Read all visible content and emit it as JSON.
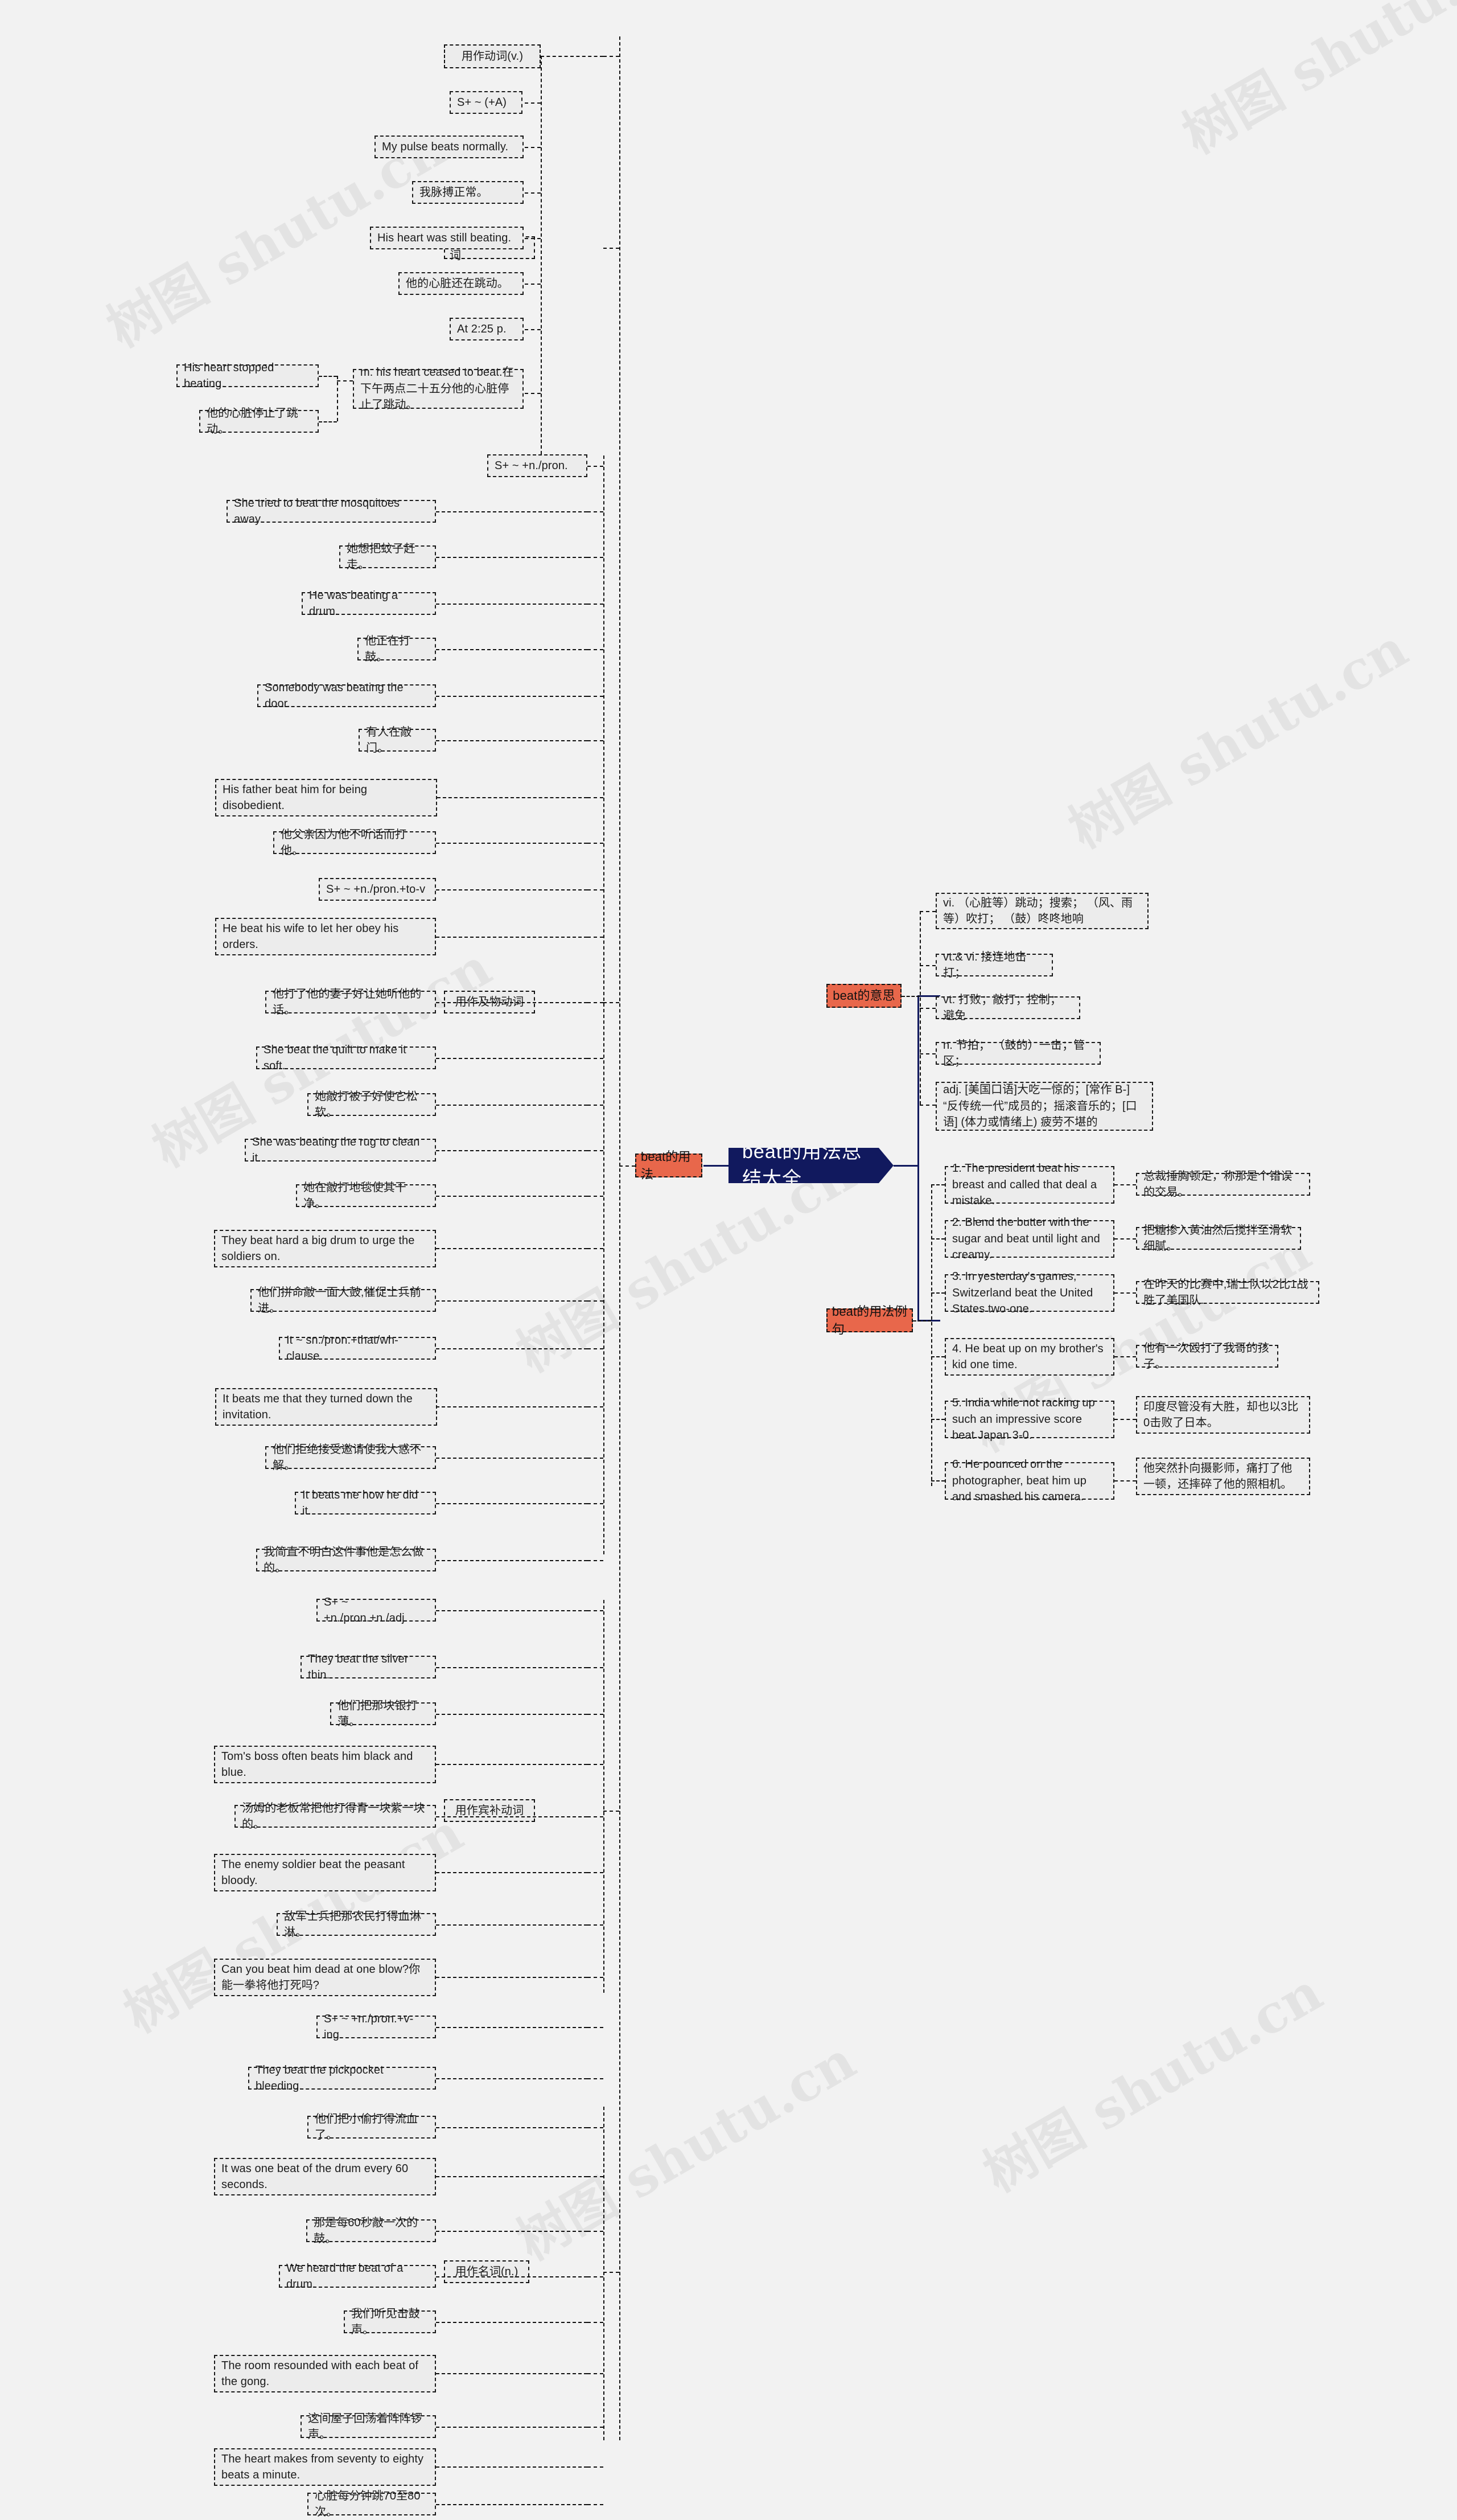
{
  "root": {
    "title": "beat的用法总结大全"
  },
  "categories": {
    "usage": "beat的用法",
    "meaning": "beat的意思",
    "examples": "beat的用法例句"
  },
  "branches": {
    "verb": "用作动词(v.)",
    "intransitive": "用作不及物动词",
    "transitive": "用作及物动词",
    "object_complement": "用作宾补动词",
    "noun": "用作名词(n.)"
  },
  "meanings": [
    "vi. （心脏等）跳动；搜索； （风、雨等）吹打； （鼓）咚咚地响",
    "vt.& vi. 接连地击打；",
    "vt. 打败；敲打；控制；避免",
    "n. 节拍； （鼓的）一击；管区；",
    "adj. [美国口语]大吃一惊的；[常作 B-] “反传统一代”成员的；摇滚音乐的；[口语] (体力或情绪上) 疲劳不堪的"
  ],
  "examples": [
    {
      "en": "1. The president beat his breast and called that deal a mistake.",
      "zh": "总裁捶胸顿足，称那是个错误的交易。"
    },
    {
      "en": "2. Blend the butter with the sugar and beat until light and creamy.",
      "zh": "把糖掺入黄油然后搅拌至滑软细腻。"
    },
    {
      "en": "3. In yesterday's games, Switzerland beat the United States two-one.",
      "zh": "在昨天的比赛中,瑞士队以2比1战胜了美国队."
    },
    {
      "en": "4. He beat up on my brother's kid one time.",
      "zh": "他有一次殴打了我哥的孩子。"
    },
    {
      "en": "5. India while not racking up such an impressive score beat Japan 3-0.",
      "zh": "印度尽管没有大胜，却也以3比0击败了日本。"
    },
    {
      "en": "6. He pounced on the photographer, beat him up and smashed his camera.",
      "zh": "他突然扑向摄影师，痛打了他一顿，还摔碎了他的照相机。"
    }
  ],
  "intransitive": {
    "pattern": "S+ ~ (+A)",
    "items": [
      "My pulse beats normally.",
      "我脉搏正常。",
      "His heart was still beating.",
      "他的心脏还在跳动。",
      "At 2:25 p.",
      "m. his heart ceased to beat.在下午两点二十五分他的心脏停止了跳动。",
      "His heart stopped beating.",
      "他的心脏停止了跳动。"
    ]
  },
  "transitive": {
    "pattern1": "S+ ~ +n./pron.",
    "pattern1_items": [
      "She tried to beat the mosquitoes away.",
      "她想把蚊子赶走。",
      "He was beating a drum.",
      "他正在打鼓。",
      "Somebody was beating the door.",
      "有人在敲门。",
      "His father beat him for being disobedient."
    ],
    "pattern1_items_extra": "他父亲因为他不听话而打他。",
    "pattern2": "S+ ~ +n./pron.+to-v",
    "pattern2_items": [
      "He beat his wife to let her obey his orders.",
      "他打了他的妻子好让她听他的话。",
      "She beat the quilt to make it soft.",
      "她敲打被子好使它松软。",
      "She was beating the rug to clean it.",
      "她在敲打地毯使其干净。",
      "They beat hard a big drum to urge the soldiers on.",
      "他们拼命敲一面大鼓,催促士兵前进。"
    ],
    "pattern3": "It ~ sn./pron.+that/wh-clause",
    "pattern3_items": [
      "It beats me that they turned down the invitation.",
      "他们拒绝接受邀请使我大惑不解。",
      "It beats me how he did it.",
      "我简直不明白这件事他是怎么做的。"
    ]
  },
  "object_complement": {
    "pattern1": "S+ ~ +n./pron.+n./adj.",
    "pattern1_items": [
      "They beat the silver thin.",
      "他们把那块银打薄。",
      "Tom's boss often beats him black and blue.",
      "汤姆的老板常把他打得青一块紫一块的。",
      "The enemy soldier beat the peasant bloody.",
      "敌军士兵把那农民打得血淋淋。",
      "Can you beat him dead at one blow?你能一拳将他打死吗?"
    ],
    "pattern2": "S+ ~ +n./pron.+v-ing",
    "pattern2_items": [
      "They beat the pickpocket bleeding.",
      "他们把小偷打得流血了。"
    ]
  },
  "noun": {
    "items": [
      "It was one beat of the drum every 60 seconds.",
      "那是每60秒敲一次的鼓。",
      "We heard the beat of a drum.",
      "我们听见击鼓声。",
      "The room resounded with each beat of the gong.",
      "这间屋子回荡着阵阵锣声。",
      "The heart makes from seventy to eighty beats a minute.",
      "心脏每分钟跳70至80次。"
    ]
  },
  "watermarks": [
    "树图 shutu.cn",
    "树图 shutu.cn",
    "树图 shutu.cn",
    "树图 shutu.cn",
    "树图 shutu.cn",
    "树图 shutu.cn",
    "树图 shutu.cn",
    "树图 shutu.cn",
    "树图 shutu.cn"
  ],
  "colors": {
    "center": "#11195e",
    "category": "#e8674b",
    "node_bg": "#ececec",
    "border": "#111111"
  }
}
